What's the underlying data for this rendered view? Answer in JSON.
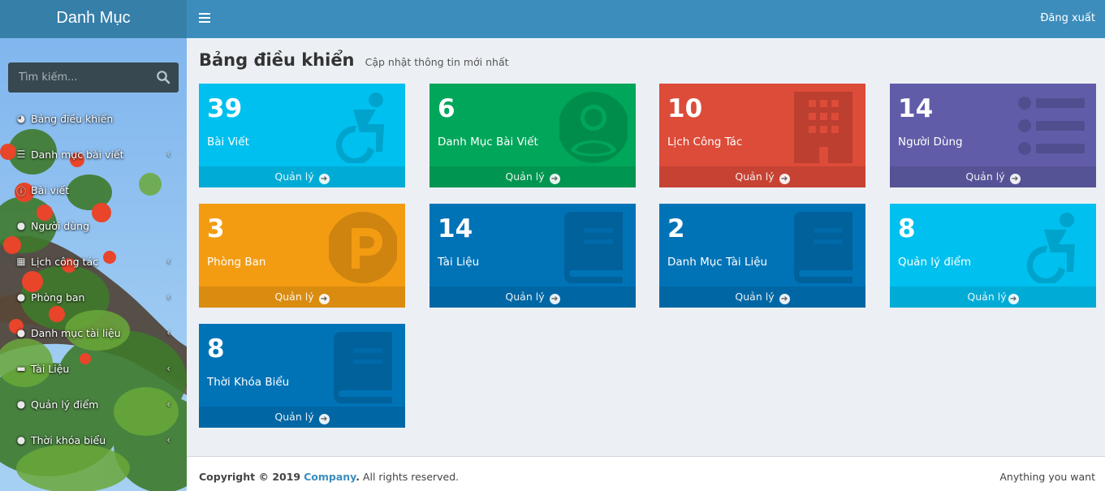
{
  "sidebar": {
    "brand": "Danh Mục",
    "search_placeholder": "Tìm kiếm...",
    "items": [
      {
        "label": "Bảng điều khiển",
        "icon": "dashboard-icon",
        "chevron": false
      },
      {
        "label": "Danh mục bài viết",
        "icon": "list-icon",
        "chevron": true
      },
      {
        "label": "Bài viết",
        "icon": "info-icon",
        "chevron": false
      },
      {
        "label": "Người dùng",
        "icon": "users-icon",
        "chevron": false
      },
      {
        "label": "Lịch công tác",
        "icon": "calendar-icon",
        "chevron": true
      },
      {
        "label": "Phòng ban",
        "icon": "users-icon",
        "chevron": true
      },
      {
        "label": "Danh mục tài liệu",
        "icon": "users-icon",
        "chevron": true
      },
      {
        "label": "Tài Liệu",
        "icon": "folder-icon",
        "chevron": true
      },
      {
        "label": "Quản lý điểm",
        "icon": "users-icon",
        "chevron": true
      },
      {
        "label": "Thời khóa biểu",
        "icon": "users-icon",
        "chevron": true
      }
    ]
  },
  "topbar": {
    "logout": "Đăng xuất"
  },
  "header": {
    "title": "Bảng điều khiển",
    "subtitle": "Cập nhật thông tin mới nhất"
  },
  "boxes": [
    {
      "count": "39",
      "label": "Bài Viết",
      "footer": "Quản lý",
      "color": "#00c0ef",
      "icon": "accessibility-icon"
    },
    {
      "count": "6",
      "label": "Danh Mục Bài Viết",
      "footer": "Quản lý",
      "color": "#00a65a",
      "icon": "user-circle-icon"
    },
    {
      "count": "10",
      "label": "Lịch Công Tác",
      "footer": "Quản lý",
      "color": "#dd4b39",
      "icon": "building-icon"
    },
    {
      "count": "14",
      "label": "Người Dùng",
      "footer": "Quản lý",
      "color": "#605ca8",
      "icon": "list-icon"
    },
    {
      "count": "3",
      "label": "Phòng Ban",
      "footer": "Quản lý",
      "color": "#f39c12",
      "icon": "parking-icon"
    },
    {
      "count": "14",
      "label": "Tài Liệu",
      "footer": "Quản lý",
      "color": "#0073b7",
      "icon": "book-icon"
    },
    {
      "count": "2",
      "label": "Danh Mục Tài Liệu",
      "footer": "Quản lý",
      "color": "#0073b7",
      "icon": "book-icon"
    },
    {
      "count": "8",
      "label": "Quản lý điểm",
      "footer": "Quản lý",
      "color": "#00c0ef",
      "icon": "accessibility-icon"
    },
    {
      "count": "8",
      "label": "Thời Khóa Biểu",
      "footer": "Quản lý",
      "color": "#0073b7",
      "icon": "book-icon"
    }
  ],
  "footer": {
    "copyright_prefix": "Copyright © 2019",
    "company": "Company",
    "rights": "All rights reserved.",
    "right_text": "Anything you want"
  }
}
